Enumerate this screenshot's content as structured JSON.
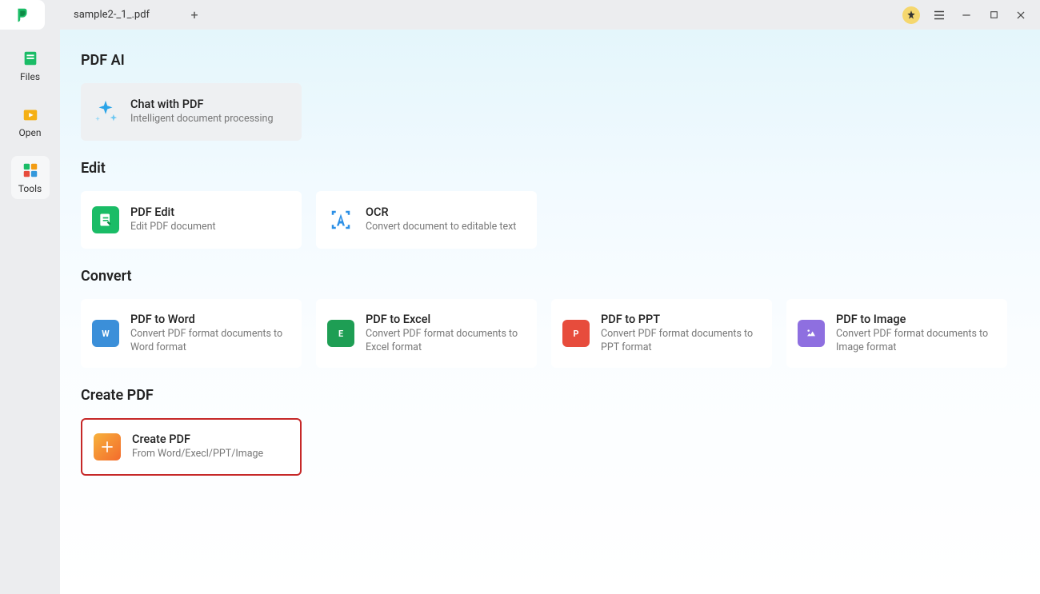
{
  "titlebar": {
    "tab_title": "sample2-_1_.pdf"
  },
  "sidebar": {
    "items": [
      {
        "label": "Files"
      },
      {
        "label": "Open"
      },
      {
        "label": "Tools"
      }
    ]
  },
  "sections": {
    "pdf_ai": {
      "heading": "PDF AI",
      "chat": {
        "title": "Chat with PDF",
        "desc": "Intelligent document processing"
      }
    },
    "edit": {
      "heading": "Edit",
      "pdf_edit": {
        "title": "PDF Edit",
        "desc": "Edit PDF document"
      },
      "ocr": {
        "title": "OCR",
        "desc": "Convert document to editable text"
      }
    },
    "convert": {
      "heading": "Convert",
      "word": {
        "title": "PDF to Word",
        "desc": "Convert PDF format documents to Word format"
      },
      "excel": {
        "title": "PDF to Excel",
        "desc": "Convert PDF format documents to Excel format"
      },
      "ppt": {
        "title": "PDF to PPT",
        "desc": "Convert PDF format documents to PPT format"
      },
      "image": {
        "title": "PDF to Image",
        "desc": "Convert PDF format documents to Image format"
      }
    },
    "create": {
      "heading": "Create PDF",
      "create": {
        "title": "Create PDF",
        "desc": "From Word/Execl/PPT/Image"
      }
    }
  }
}
